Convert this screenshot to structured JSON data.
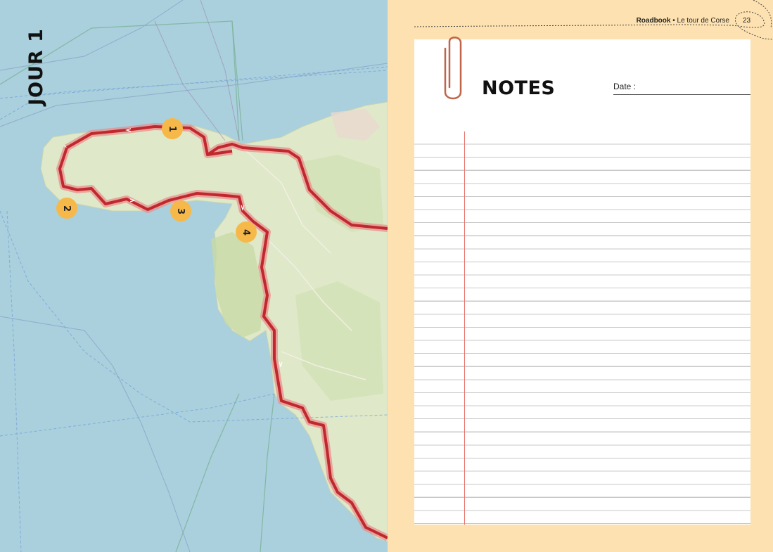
{
  "map": {
    "day_label": "JOUR 1",
    "markers": [
      "1",
      "2",
      "3",
      "4"
    ]
  },
  "page": {
    "header_bold": "Roadbook",
    "header_rest": " • Le tour de Corse",
    "page_number": "23"
  },
  "notes": {
    "title": "NOTES",
    "date_label": "Date :"
  },
  "colors": {
    "sea": "#a9d0dc",
    "land": "#dfe8c8",
    "route": "#c0282d",
    "marker": "#f7b84a",
    "background": "#fde1b0",
    "margin_line": "#e5736a"
  }
}
